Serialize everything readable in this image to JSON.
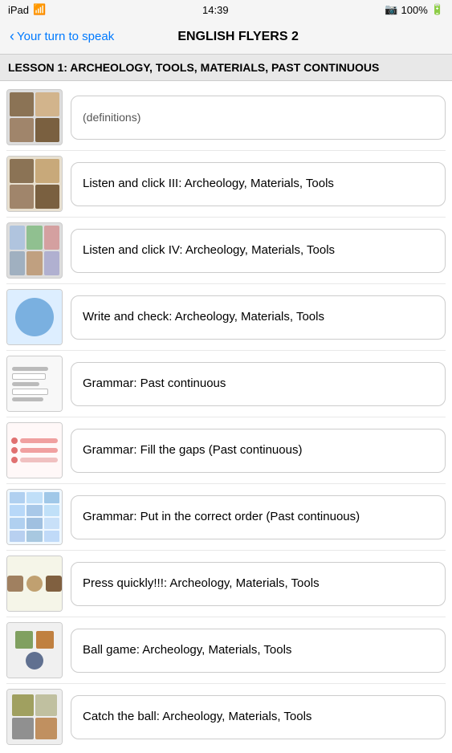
{
  "status": {
    "carrier": "iPad",
    "wifi": "WiFi",
    "time": "14:39",
    "bluetooth": "BT",
    "battery": "100%"
  },
  "nav": {
    "back_label": "Your turn to speak",
    "title": "ENGLISH FLYERS 2"
  },
  "lesson": {
    "header": "LESSON 1: ARCHEOLOGY, TOOLS, MATERIALS, PAST CONTINUOUS"
  },
  "partial_top": {
    "label": "(definitions)"
  },
  "items": [
    {
      "id": "listen3",
      "label": "Listen and click III: Archeology, Materials, Tools",
      "thumb_type": "listen3"
    },
    {
      "id": "listen4",
      "label": "Listen and click IV: Archeology, Materials, Tools",
      "thumb_type": "listen4"
    },
    {
      "id": "write",
      "label": "Write and check: Archeology, Materials, Tools",
      "thumb_type": "write"
    },
    {
      "id": "grammar1",
      "label": "Grammar: Past continuous",
      "thumb_type": "grammar1"
    },
    {
      "id": "grammar2",
      "label": "Grammar: Fill the gaps (Past continuous)",
      "thumb_type": "grammar2"
    },
    {
      "id": "grammar3",
      "label": "Grammar: Put in the correct order (Past continuous)",
      "thumb_type": "grammar3"
    },
    {
      "id": "press",
      "label": "Press quickly!!!: Archeology, Materials, Tools",
      "thumb_type": "press"
    },
    {
      "id": "ball",
      "label": "Ball game: Archeology, Materials, Tools",
      "thumb_type": "ball"
    },
    {
      "id": "catch",
      "label": "Catch the ball: Archeology, Materials, Tools",
      "thumb_type": "catch"
    }
  ]
}
